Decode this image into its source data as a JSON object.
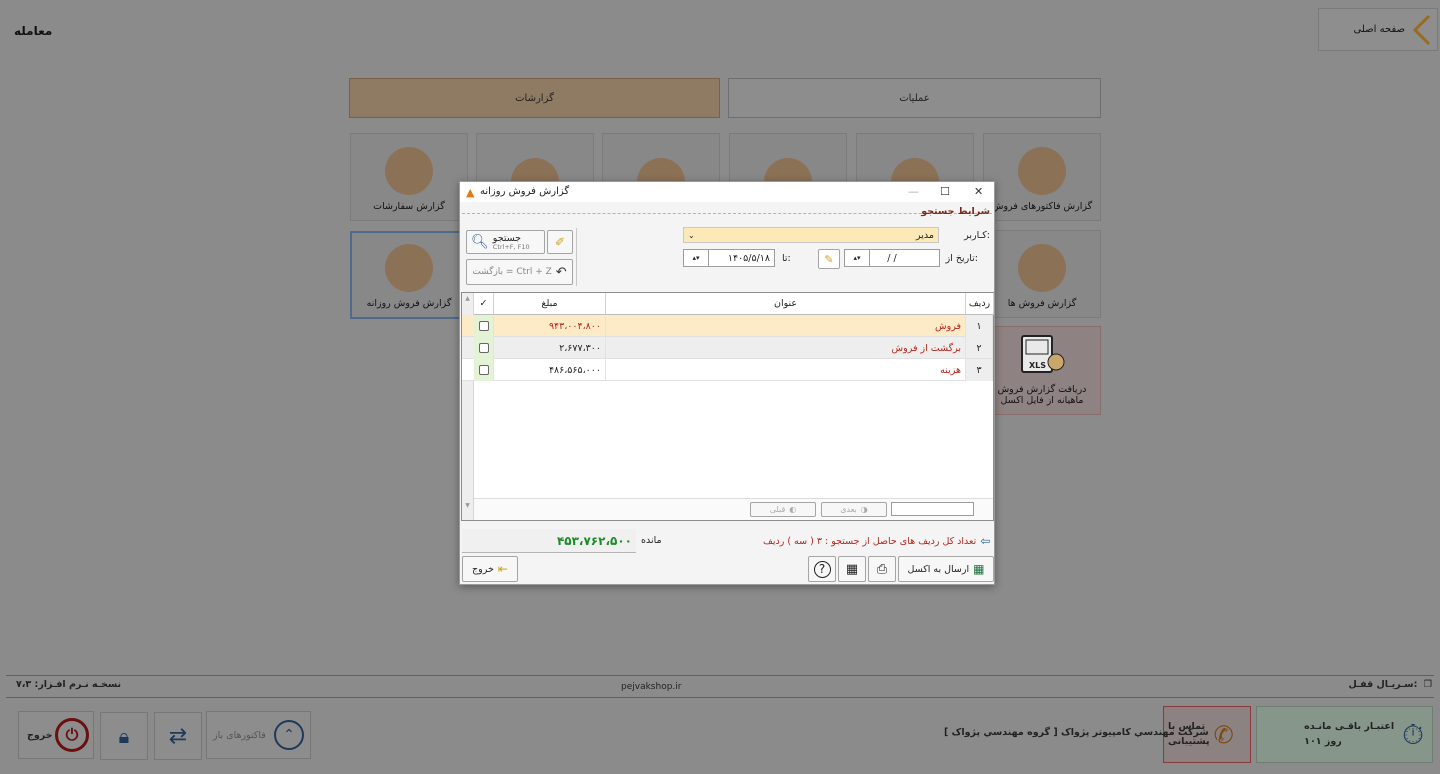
{
  "page": {
    "title": "معامله",
    "home_label": "صفحه اصلی"
  },
  "tabs": [
    {
      "label": "عملیات"
    },
    {
      "label": "گزارشات"
    }
  ],
  "tiles_row1": [
    {
      "label": "گزارش فاکتورهای فروش"
    },
    {
      "label": ""
    },
    {
      "label": ""
    },
    {
      "label": ""
    },
    {
      "label": ""
    },
    {
      "label": "گزارش سفارشات"
    }
  ],
  "tiles_row2": [
    {
      "label": "گزارش فروش ها"
    },
    {
      "label": "گزارش فروش روزانه"
    }
  ],
  "tile_excel": {
    "label": "دریافت گزارش فروش ماهیانه از فایل اکسل",
    "badge": "XLS"
  },
  "dialog": {
    "title": "گزارش فروش روزانه",
    "section_title": "شرایط جستجو",
    "user_label": "کـاربر:",
    "user_value": "مدیر",
    "date_from_label": "تاریخ از:",
    "date_from_value": "/   /",
    "date_to_label": "تا:",
    "date_to_value": "۱۴۰۵/۵/۱۸",
    "search_label": "جستجو",
    "search_shortcut": "Ctrl+F, F10",
    "back_label": "بازگشت = Ctrl + Z",
    "columns": [
      "ردیف",
      "عنوان",
      "مبلغ",
      "✓"
    ],
    "rows": [
      {
        "num": "۱",
        "title": "فروش",
        "amount": "۹۴۳،۰۰۴،۸۰۰"
      },
      {
        "num": "۲",
        "title": "برگشت از فروش",
        "amount": "۲،۶۷۷،۳۰۰"
      },
      {
        "num": "۳",
        "title": "هزینه",
        "amount": "۴۸۶،۵۶۵،۰۰۰"
      }
    ],
    "next_label": "بعدی",
    "prev_label": "قبلی",
    "count_text": "تعداد کل ردیف های حاصل از جستجو : ۳ ( سه ) ردیف",
    "remain_label": "مانده",
    "remain_value": "۴۵۳،۷۶۲،۵۰۰",
    "excel_label": "ارسال به اکسل",
    "exit_label": "خروج"
  },
  "footer": {
    "serial_label": "سـریـال قفـل:",
    "site": "pejvakshop.ir",
    "version": "نسخـه نـرم افـزار: ۷،۳",
    "company": "شرکت مهندسي کامپيوتر پژواک [ گروه مهندسي پژواک ]",
    "credit_label": "اعتبـار باقـی مانـده",
    "credit_value": "۱۰۱ روز",
    "support_label_1": "تماس با",
    "support_label_2": "پشتیبانی",
    "open_invoices": "فاکتورهای باز",
    "exit": "خروج"
  },
  "colors": {
    "accent": "#f0a64a",
    "money_green": "#1e8a2a",
    "red_text": "#b3261e"
  }
}
